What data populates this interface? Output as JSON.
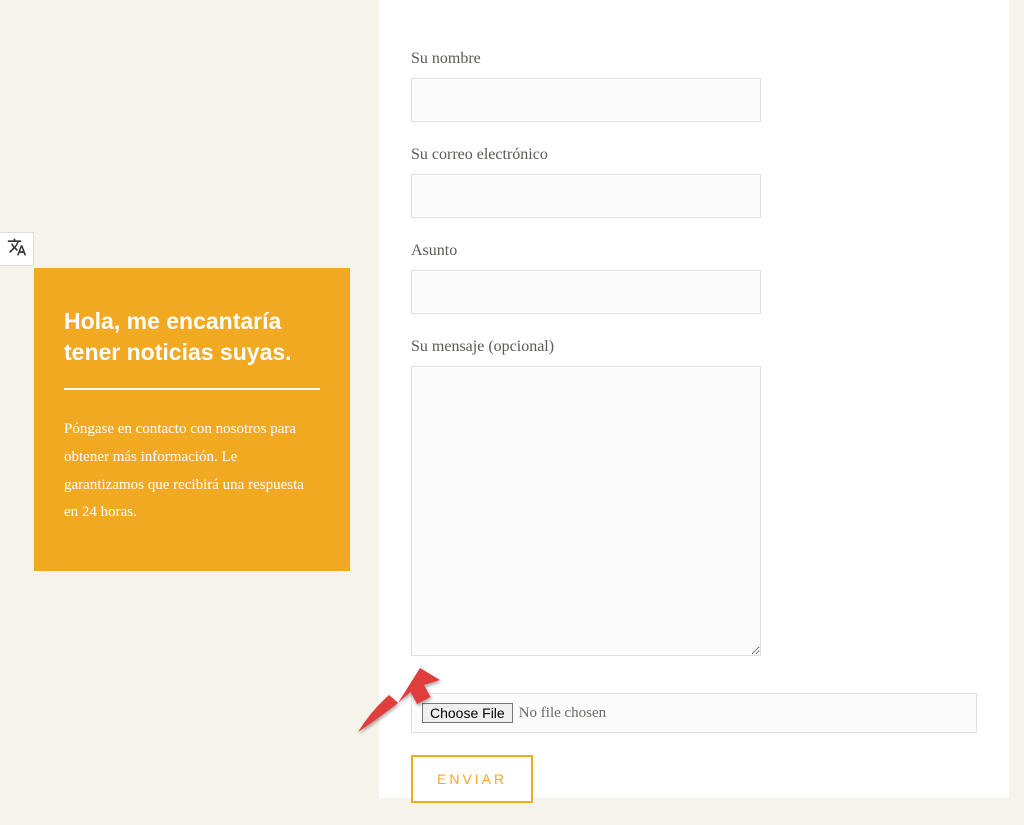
{
  "sidebar": {
    "title": "Hola, me encantaría tener noticias suyas.",
    "description": "Póngase en contacto con nosotros para obtener más información. Le garantizamos que recibirá una respuesta en 24 horas."
  },
  "form": {
    "name_label": "Su nombre",
    "email_label": "Su correo electrónico",
    "subject_label": "Asunto",
    "message_label": "Su mensaje (opcional)",
    "choose_file_label": "Choose File",
    "file_status": "No file chosen",
    "submit_label": "ENVIAR"
  }
}
